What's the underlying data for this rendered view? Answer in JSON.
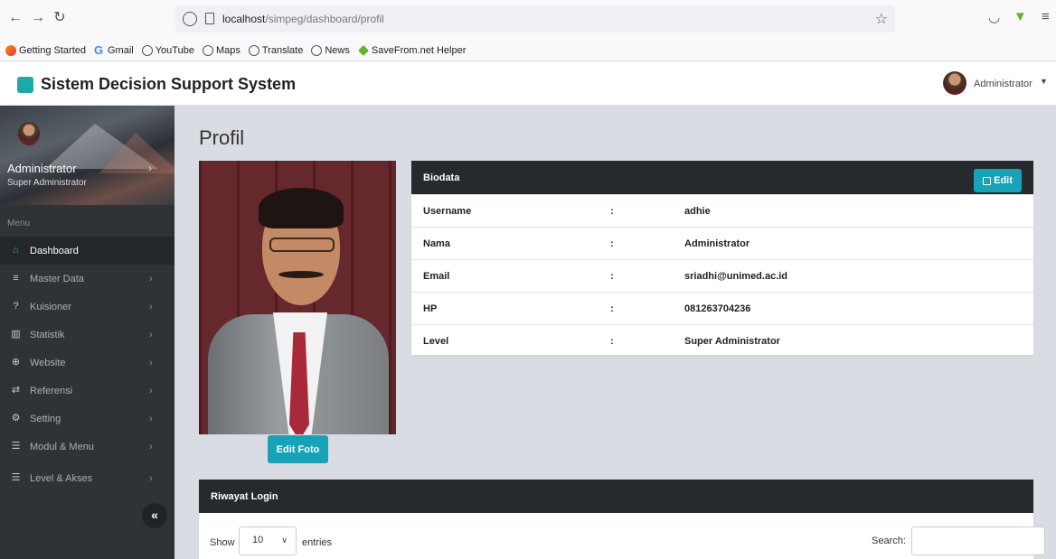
{
  "browser": {
    "url_host": "localhost",
    "url_path": "/simpeg/dashboard/profil",
    "bookmarks": [
      "Getting Started",
      "Gmail",
      "YouTube",
      "Maps",
      "Translate",
      "News",
      "SaveFrom.net Helper"
    ]
  },
  "header": {
    "title": "Sistem Decision Support System",
    "user": "Administrator"
  },
  "sidebar": {
    "name": "Administrator",
    "role": "Super Administrator",
    "menu_label": "Menu",
    "items": [
      {
        "label": "Dashboard",
        "icon": "home-icon"
      },
      {
        "label": "Master Data",
        "icon": "database-icon"
      },
      {
        "label": "Kuisioner",
        "icon": "question-icon"
      },
      {
        "label": "Statistik",
        "icon": "chart-icon"
      },
      {
        "label": "Website",
        "icon": "globe-icon"
      },
      {
        "label": "Referensi",
        "icon": "exchange-icon"
      },
      {
        "label": "Setting",
        "icon": "cogs-icon"
      },
      {
        "label": "Modul & Menu",
        "icon": "list-icon"
      },
      {
        "label": "Level & Akses",
        "icon": "list-icon"
      }
    ],
    "collapse_glyph": "«"
  },
  "main": {
    "page_title": "Profil",
    "edit_foto_label": "Edit Foto",
    "biodata": {
      "title": "Biodata",
      "edit_label": "Edit",
      "rows": [
        {
          "key": "Username",
          "value": "adhie"
        },
        {
          "key": "Nama",
          "value": "Administrator"
        },
        {
          "key": "Email",
          "value": "sriadhi@unimed.ac.id"
        },
        {
          "key": "HP",
          "value": "081263704236"
        },
        {
          "key": "Level",
          "value": "Super Administrator"
        }
      ],
      "separator": ":"
    },
    "riwayat": {
      "title": "Riwayat Login",
      "show_label": "Show",
      "show_value": "10",
      "entries_label": "entries",
      "search_label": "Search:"
    }
  }
}
